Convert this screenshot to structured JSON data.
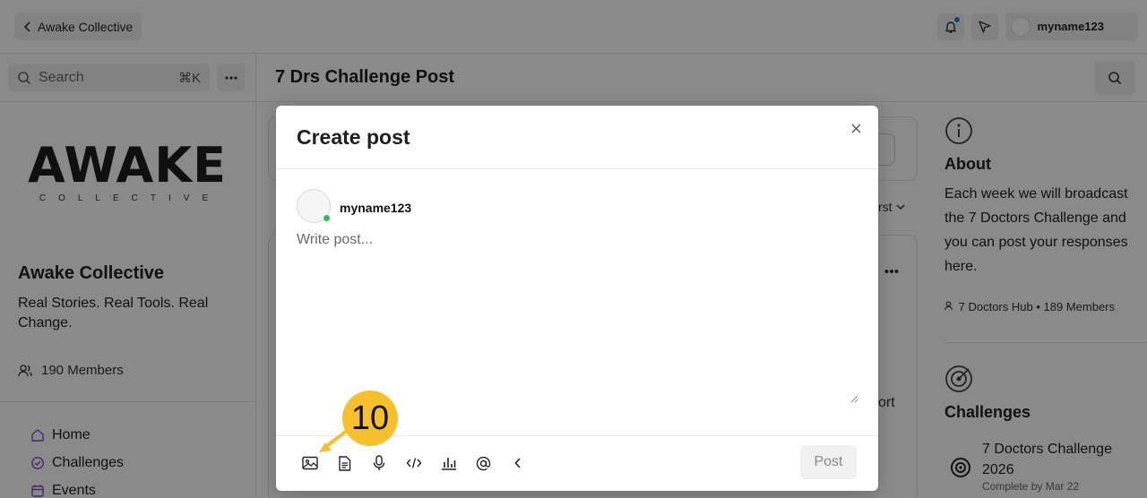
{
  "topbar": {
    "back_label": "Awake Collective",
    "user_name": "myname123"
  },
  "sidebar": {
    "search_placeholder": "Search",
    "search_shortcut": "⌘K",
    "logo_main": "AWAKE",
    "logo_sub": "COLLECTIVE",
    "community_name": "Awake Collective",
    "tagline": "Real Stories. Real Tools. Real Change.",
    "members": "190 Members",
    "nav": [
      {
        "label": "Home",
        "icon": "home-icon"
      },
      {
        "label": "Challenges",
        "icon": "badge-check-icon"
      },
      {
        "label": "Events",
        "icon": "calendar-icon"
      }
    ]
  },
  "main": {
    "page_title": "7 Drs Challenge Post",
    "sort_label": "rst",
    "report_label": "ort"
  },
  "right_panel": {
    "about_title": "About",
    "about_text": "Each week we will broadcast the 7 Doctors Challenge and you can post your responses here.",
    "hub_name": "7 Doctors Hub",
    "hub_separator": "•",
    "hub_members": "189 Members",
    "challenges_title": "Challenges",
    "challenge_name": "7 Doctors Challenge 2026",
    "challenge_meta": "Complete by Mar 22"
  },
  "modal": {
    "title": "Create post",
    "author": "myname123",
    "placeholder": "Write post...",
    "post_label": "Post",
    "tools": [
      "image-icon",
      "document-icon",
      "microphone-icon",
      "code-icon",
      "chart-icon",
      "mention-icon",
      "collapse-icon"
    ]
  },
  "annotation": {
    "step": "10",
    "color": "#f6c02c"
  }
}
